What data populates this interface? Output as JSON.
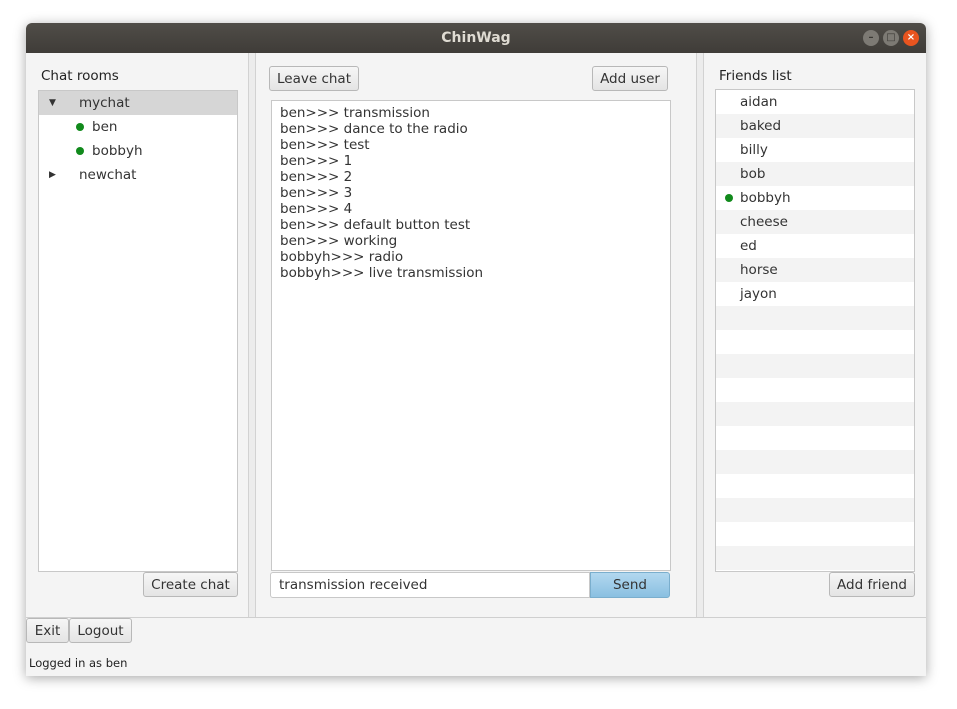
{
  "window": {
    "title": "ChinWag"
  },
  "chat_rooms": {
    "label": "Chat rooms",
    "rooms": [
      {
        "name": "mychat",
        "expanded": true,
        "selected": true,
        "members": [
          "ben",
          "bobbyh"
        ]
      },
      {
        "name": "newchat",
        "expanded": false,
        "selected": false,
        "members": []
      }
    ],
    "create_label": "Create chat"
  },
  "chat": {
    "leave_label": "Leave chat",
    "add_user_label": "Add user",
    "messages": [
      "ben>>> transmission",
      "ben>>> dance to the radio",
      "ben>>> test",
      "ben>>> 1",
      "ben>>> 2",
      "ben>>> 3",
      "ben>>> 4",
      "ben>>> default button test",
      "ben>>> working",
      "bobbyh>>> radio",
      "bobbyh>>> live transmission"
    ],
    "input_value": "transmission received",
    "send_label": "Send"
  },
  "friends": {
    "label": "Friends list",
    "items": [
      {
        "name": "aidan",
        "online": false
      },
      {
        "name": "baked",
        "online": false
      },
      {
        "name": "billy",
        "online": false
      },
      {
        "name": "bob",
        "online": false
      },
      {
        "name": "bobbyh",
        "online": true
      },
      {
        "name": "cheese",
        "online": false
      },
      {
        "name": "ed",
        "online": false
      },
      {
        "name": "horse",
        "online": false
      },
      {
        "name": "jayon",
        "online": false
      }
    ],
    "add_label": "Add friend"
  },
  "footer": {
    "exit_label": "Exit",
    "logout_label": "Logout",
    "status": "Logged in as ben"
  },
  "colors": {
    "online": "#118a1c",
    "primary_button": "#9ccbe8",
    "titlebar": "#45423e",
    "close_button": "#e9541f"
  },
  "icons": {
    "expanded": "triangle-down-icon",
    "collapsed": "triangle-right-icon",
    "online": "online-dot-icon"
  }
}
